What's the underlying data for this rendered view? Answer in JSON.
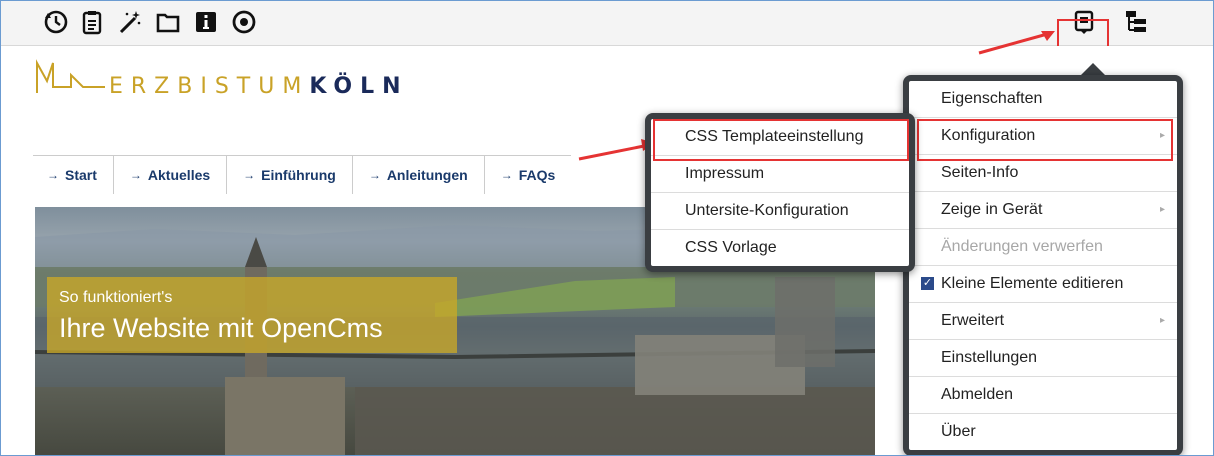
{
  "toolbar": {
    "left_icons": [
      "history-icon",
      "clipboard-icon",
      "magic-wand-icon",
      "folder-icon",
      "info-icon",
      "target-icon"
    ],
    "right_icons": [
      "context-menu-icon",
      "sitemap-icon"
    ]
  },
  "site": {
    "logo_text_main": "ERZBISTUM",
    "logo_text_bold": "KÖLN",
    "nav": [
      {
        "arrow": "→",
        "label": "Start"
      },
      {
        "arrow": "→",
        "label": "Aktuelles"
      },
      {
        "arrow": "→",
        "label": "Einführung"
      },
      {
        "arrow": "→",
        "label": "Anleitungen"
      },
      {
        "arrow": "→",
        "label": "FAQs"
      }
    ],
    "hero": {
      "subtitle": "So funktioniert's",
      "title": "Ihre Website mit OpenCms"
    }
  },
  "main_menu": {
    "items": [
      {
        "label": "Eigenschaften"
      },
      {
        "label": "Konfiguration",
        "submenu_arrow": "▸"
      },
      {
        "label": "Seiten-Info"
      },
      {
        "label": "Zeige in Gerät",
        "submenu_arrow": "▸"
      },
      {
        "label": "Änderungen verwerfen"
      },
      {
        "label": "Kleine Elemente editieren",
        "check": "✓"
      },
      {
        "label": "Erweitert",
        "submenu_arrow": "▸"
      },
      {
        "label": "Einstellungen"
      },
      {
        "label": "Abmelden"
      },
      {
        "label": "Über"
      }
    ]
  },
  "sub_menu": {
    "items": [
      {
        "label": "CSS Templateeinstellung"
      },
      {
        "label": "Impressum"
      },
      {
        "label": "Untersite-Konfiguration"
      },
      {
        "label": "CSS Vorlage"
      }
    ]
  },
  "colors": {
    "accent_red": "#e53333",
    "nav_text": "#1a3a6b",
    "logo_gold": "#c9a227",
    "logo_dark": "#1a2a5a",
    "menu_border": "#3a3e42"
  }
}
